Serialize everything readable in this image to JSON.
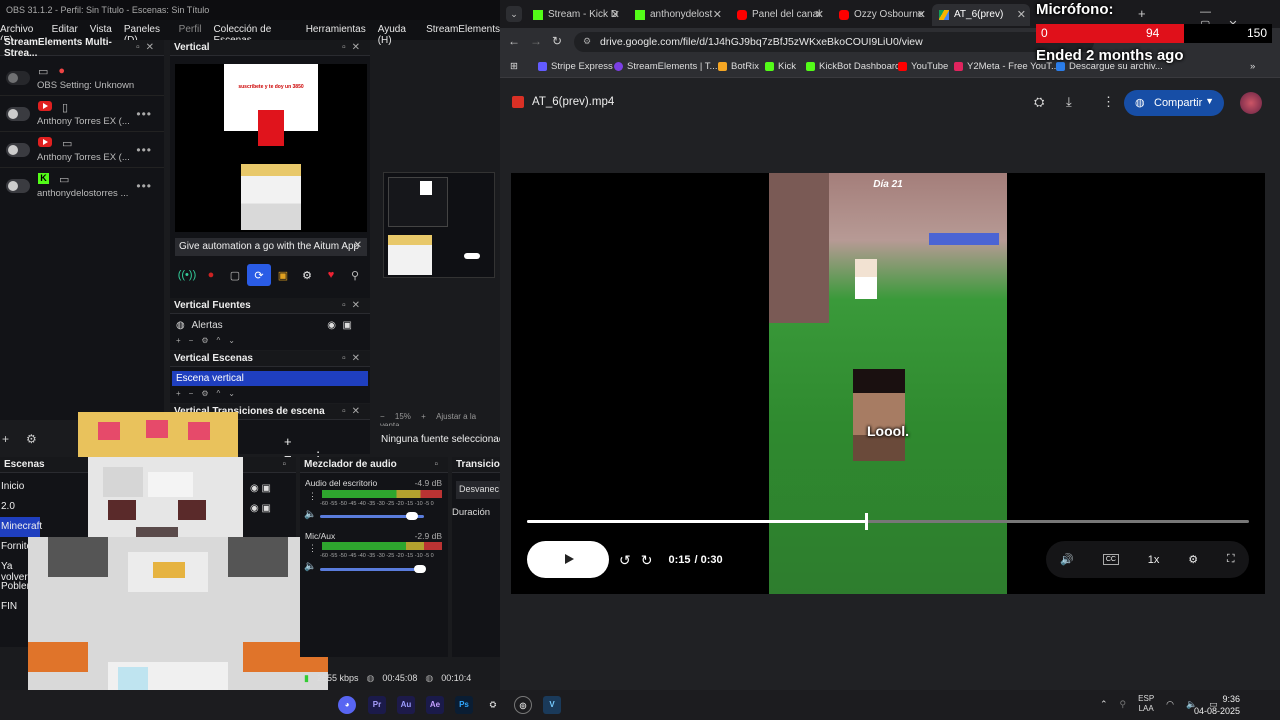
{
  "obs": {
    "title": "OBS 31.1.2 - Perfil: Sin Título - Escenas: Sin Título",
    "menu": [
      "Archivo (F)",
      "Editar",
      "Vista",
      "Paneles (D)",
      "Perfil",
      "Colección de Escenas",
      "Herramientas",
      "Ayuda (H)",
      "StreamElements"
    ],
    "se_panel": {
      "title": "StreamElements Multi-Strea...",
      "rows": [
        {
          "label": "OBS Setting: Unknown"
        },
        {
          "label": "Anthony Torres EX (..."
        },
        {
          "label": "Anthony Torres EX (..."
        },
        {
          "label": "anthonydelostorres ..."
        }
      ]
    },
    "vertical": {
      "title": "Vertical",
      "card_text": "suscríbete y te doy un 3850",
      "aitum": "Give automation a go with the Aitum App"
    },
    "vfuentes": {
      "title": "Vertical Fuentes",
      "item": "Alertas"
    },
    "vescenas": {
      "title": "Vertical Escenas",
      "item": "Escena vertical"
    },
    "vtrans": {
      "title": "Vertical Transiciones de escena"
    },
    "zoom": {
      "pct": "15%",
      "fit": "Ajustar a la venta"
    },
    "ninguna": "Ninguna fuente seleccionada",
    "escenas": {
      "title": "Escenas",
      "items": [
        "Inicio",
        "2.0",
        "Minecraft",
        "Fornite",
        "Ya volver",
        "Poblema",
        "FIN"
      ]
    },
    "mixer": {
      "title": "Mezclador de audio",
      "ch1": {
        "name": "Audio del escritorio",
        "db": "-4.9 dB",
        "ticks": "-60 -55 -50 -45 -40 -35 -30 -25 -20 -15 -10 -5 0"
      },
      "ch2": {
        "name": "Mic/Aux",
        "db": "-2.9 dB",
        "ticks": "-60 -55 -50 -45 -40 -35 -30 -25 -20 -15 -10 -5 0"
      }
    },
    "transic": {
      "title": "Transicio",
      "desvan": "Desvanec",
      "duracion": "Duración"
    },
    "status": {
      "bitrate": "2655 kbps",
      "time1": "00:45:08",
      "time2": "00:10:4"
    }
  },
  "chrome": {
    "tabs": [
      {
        "label": "Stream - Kick D",
        "color": "#53fc18"
      },
      {
        "label": "anthonydelost",
        "color": "#53fc18"
      },
      {
        "label": "Panel del canal",
        "color": "#ff0000"
      },
      {
        "label": "Ozzy Osbourne",
        "color": "#ff0000"
      },
      {
        "label": "AT_6(prev)",
        "color": "#4285f4"
      }
    ],
    "url": "drive.google.com/file/d/1J4hGJ9bq7zBfJ5zWKxeBkoCOUI9LiU0/view",
    "bookmarks": [
      {
        "label": "Stripe Express",
        "color": "#635bff"
      },
      {
        "label": "StreamElements | T...",
        "color": "#7b3fe4"
      },
      {
        "label": "BotRix",
        "color": "#f5a623"
      },
      {
        "label": "Kick",
        "color": "#53fc18"
      },
      {
        "label": "KickBot Dashboard",
        "color": "#53fc18"
      },
      {
        "label": "YouTube",
        "color": "#ff0000"
      },
      {
        "label": "Y2Meta - Free YouT...",
        "color": "#e0245e"
      },
      {
        "label": "Descargue su archiv...",
        "color": "#2b7de9"
      }
    ],
    "file_name": "AT_6(prev).mp4",
    "share_label": "Compartir",
    "video": {
      "day_text": "Día 21",
      "subtitle": "Loool.",
      "current": "0:15",
      "total": "/ 0:30",
      "progress": 0.47,
      "speed": "1x"
    }
  },
  "overlay": {
    "title": "Micrófono:",
    "min": "0",
    "value": "94",
    "max": "150",
    "fill_fraction": 0.627,
    "ended": "Ended 2 months ago"
  },
  "taskbar": {
    "lang1": "ESP",
    "lang2": "LAA",
    "time": "9:36",
    "date": "04-08-2025"
  }
}
